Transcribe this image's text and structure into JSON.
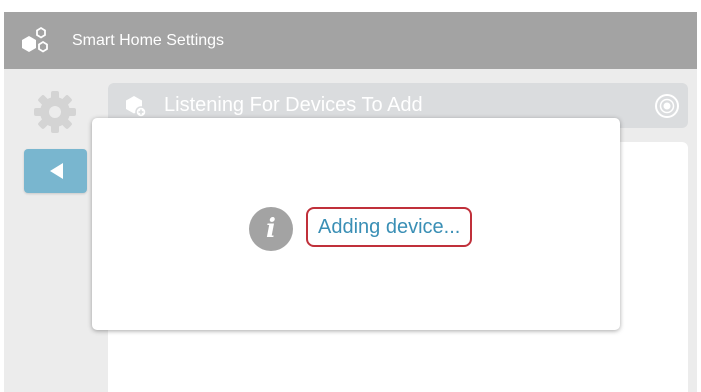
{
  "titlebar": {
    "title": "Smart Home Settings",
    "icon": "smart-home-cubes-icon"
  },
  "sidebar": {
    "gear_icon": "gear-icon",
    "back_icon": "back-arrow-icon"
  },
  "header": {
    "title": "Listening For Devices To Add",
    "icon": "add-device-icon",
    "right_icon": "target-icon"
  },
  "dialog": {
    "status_text": "Adding device...",
    "icon": "info-icon",
    "info_glyph": "i"
  },
  "colors": {
    "titlebar": "#a3a3a3",
    "back_button": "#79b6cf",
    "status_text": "#3a8fb5",
    "highlight_border": "#c0303a"
  }
}
